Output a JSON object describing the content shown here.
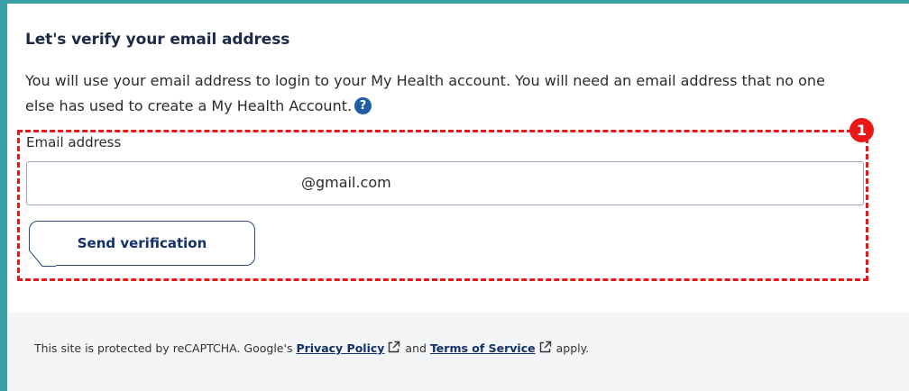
{
  "verify": {
    "heading": "Let's verify your email address",
    "description": "You will use your email address to login to your My Health account. You will need an email address that no one else has used to create a My Health Account.",
    "help_icon": "question-circle-icon",
    "help_glyph": "?"
  },
  "annotation": {
    "badge": "1",
    "color": "#e81818"
  },
  "form": {
    "email_label": "Email address",
    "email_value": "@gmail.com",
    "send_button": "Send verification"
  },
  "footer": {
    "prefix": "This site is protected by reCAPTCHA. Google's",
    "privacy_link": "Privacy Policy",
    "and_text": "and",
    "terms_link": "Terms of Service",
    "suffix": "apply.",
    "external_icon": "external-link-icon"
  },
  "colors": {
    "accent_border": "#3aa0a8",
    "heading_text": "#1b2a4a",
    "link_text": "#13306a",
    "help_icon": "#1f5fa8"
  }
}
